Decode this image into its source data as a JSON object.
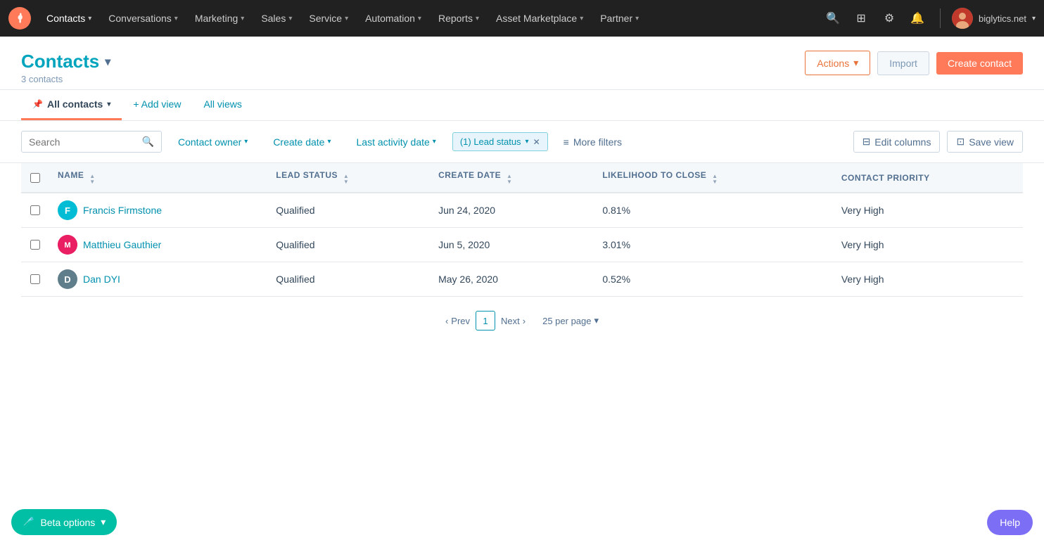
{
  "topnav": {
    "logo_label": "HubSpot",
    "nav_items": [
      {
        "label": "Contacts",
        "chevron": true,
        "active": true
      },
      {
        "label": "Conversations",
        "chevron": true
      },
      {
        "label": "Marketing",
        "chevron": true
      },
      {
        "label": "Sales",
        "chevron": true
      },
      {
        "label": "Service",
        "chevron": true
      },
      {
        "label": "Automation",
        "chevron": true
      },
      {
        "label": "Reports",
        "chevron": true
      },
      {
        "label": "Asset Marketplace",
        "chevron": true
      },
      {
        "label": "Partner",
        "chevron": true
      }
    ],
    "user": {
      "name": "biglytics.net",
      "avatar_bg": "#c0392b"
    }
  },
  "page": {
    "title": "Contacts",
    "subtitle": "3 contacts",
    "actions_label": "Actions",
    "import_label": "Import",
    "create_label": "Create contact"
  },
  "tabs": [
    {
      "label": "All contacts",
      "active": true,
      "pinned": true
    },
    {
      "label": "+ Add view"
    },
    {
      "label": "All views"
    }
  ],
  "filters": {
    "search_placeholder": "Search",
    "contact_owner_label": "Contact owner",
    "create_date_label": "Create date",
    "last_activity_label": "Last activity date",
    "lead_status_label": "(1) Lead status",
    "more_filters_label": "More filters",
    "edit_columns_label": "Edit columns",
    "save_view_label": "Save view"
  },
  "table": {
    "columns": [
      {
        "key": "name",
        "label": "NAME"
      },
      {
        "key": "lead_status",
        "label": "LEAD STATUS"
      },
      {
        "key": "create_date",
        "label": "CREATE DATE"
      },
      {
        "key": "likelihood",
        "label": "LIKELIHOOD TO CLOSE"
      },
      {
        "key": "priority",
        "label": "CONTACT PRIORITY"
      }
    ],
    "rows": [
      {
        "name": "Francis Firmstone",
        "initials": "F",
        "avatar_class": "avatar-f",
        "lead_status": "Qualified",
        "create_date": "Jun 24, 2020",
        "likelihood": "0.81%",
        "priority": "Very High"
      },
      {
        "name": "Matthieu Gauthier",
        "initials": "M",
        "avatar_class": "avatar-m",
        "lead_status": "Qualified",
        "create_date": "Jun 5, 2020",
        "likelihood": "3.01%",
        "priority": "Very High"
      },
      {
        "name": "Dan DYI",
        "initials": "D",
        "avatar_class": "avatar-d",
        "lead_status": "Qualified",
        "create_date": "May 26, 2020",
        "likelihood": "0.52%",
        "priority": "Very High"
      }
    ]
  },
  "pagination": {
    "prev_label": "Prev",
    "next_label": "Next",
    "current_page": "1",
    "per_page_label": "25 per page"
  },
  "beta": {
    "label": "Beta options"
  },
  "help": {
    "label": "Help"
  }
}
